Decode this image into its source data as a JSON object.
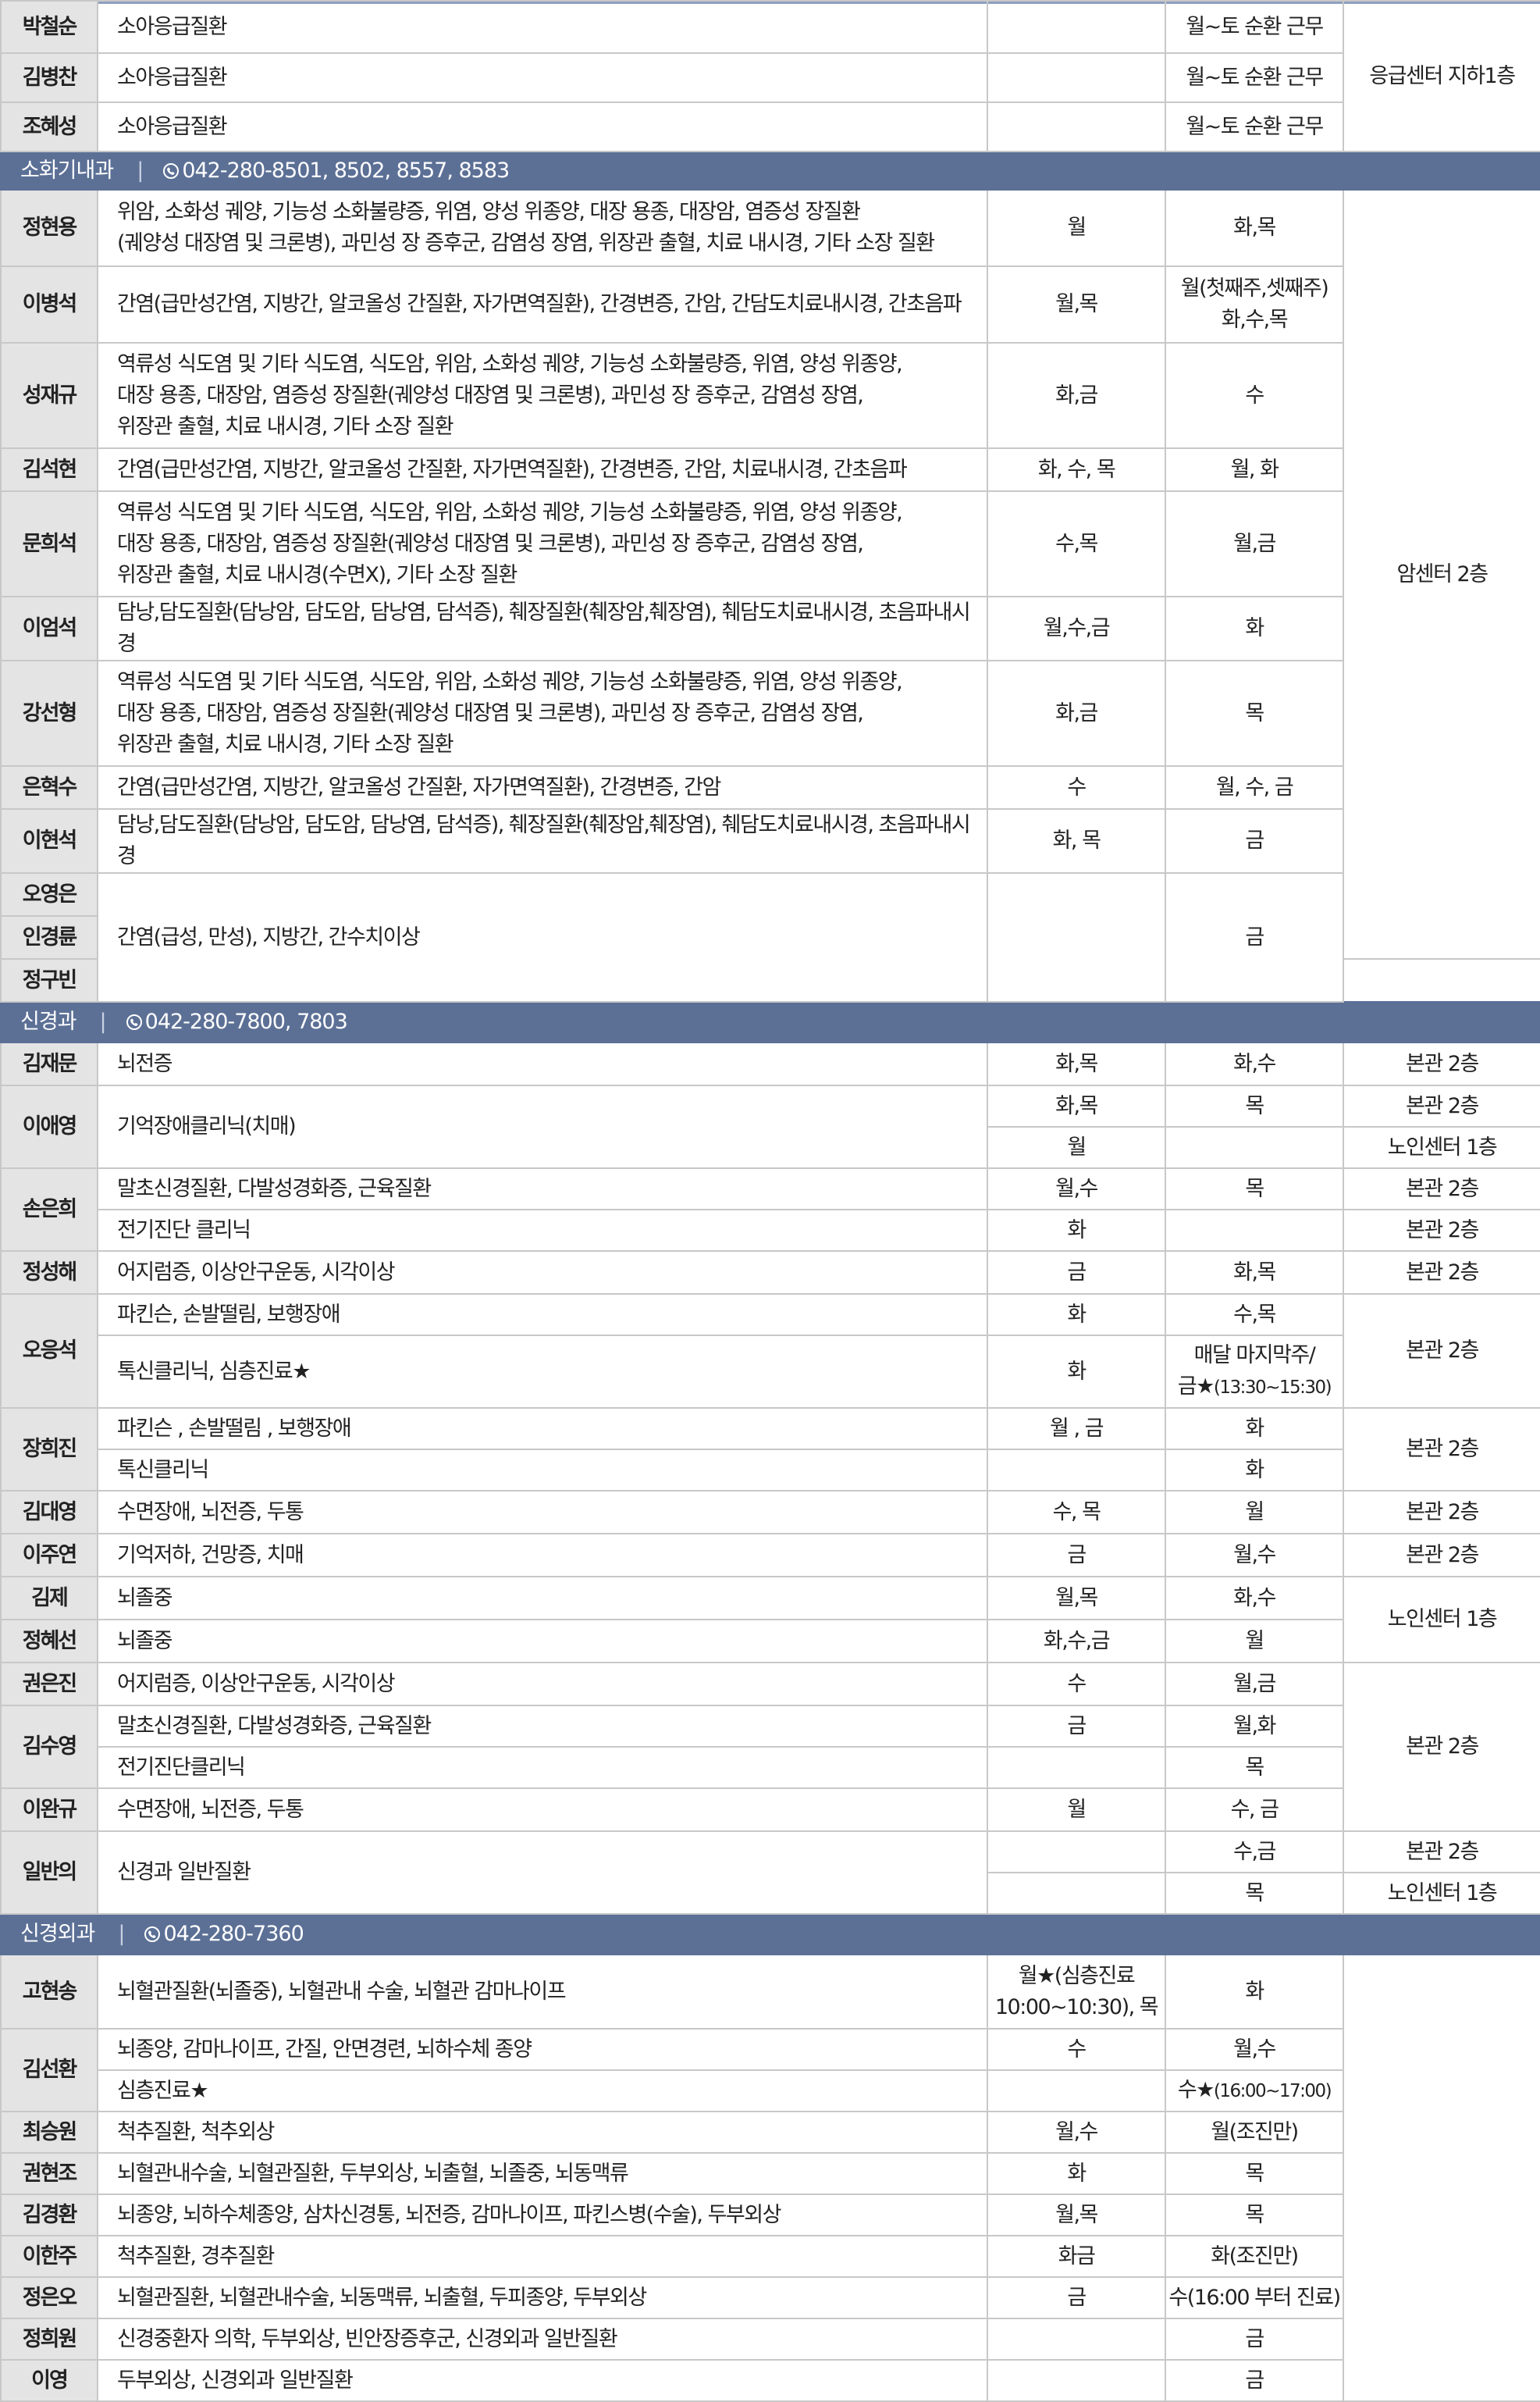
{
  "sections": {
    "pediatrics_tail": {
      "rows": [
        {
          "name": "박철순",
          "specialty": "소아응급질환",
          "clinic": "",
          "surgery": "월~토 순환 근무"
        },
        {
          "name": "김병찬",
          "specialty": "소아응급질환",
          "clinic": "",
          "surgery": "월~토 순환 근무"
        },
        {
          "name": "조혜성",
          "specialty": "소아응급질환",
          "clinic": "",
          "surgery": "월~토 순환 근무"
        }
      ],
      "location": "응급센터 지하1층"
    },
    "gastro": {
      "dept_name": "소화기내과",
      "phone": "042-280-8501, 8502, 8557, 8583",
      "location": "암센터 2층",
      "rows": [
        {
          "name": "정현용",
          "specialty": "위암, 소화성 궤양, 기능성 소화불량증, 위염, 양성 위종양, 대장 용종, 대장암, 염증성 장질환",
          "specialty2": "(궤양성 대장염 및 크론병), 과민성 장 증후군, 감염성 장염, 위장관 출혈, 치료 내시경, 기타 소장 질환",
          "clinic": "월",
          "surgery": "화,목"
        },
        {
          "name": "이병석",
          "specialty": "간염(급만성간염, 지방간, 알코올성 간질환, 자가면역질환), 간경변증, 간암, 간담도치료내시경, 간초음파",
          "clinic": "월,목",
          "surgery": "월(첫째주,셋째주)",
          "surgery2": "화,수,목"
        },
        {
          "name": "성재규",
          "specialty": "역류성 식도염 및 기타 식도염, 식도암, 위암, 소화성 궤양, 기능성 소화불량증, 위염, 양성 위종양,",
          "specialty2": "대장 용종, 대장암, 염증성 장질환(궤양성 대장염 및 크론병), 과민성 장 증후군, 감염성 장염,",
          "specialty3": "위장관 출혈, 치료 내시경, 기타 소장 질환",
          "clinic": "화,금",
          "surgery": "수"
        },
        {
          "name": "김석현",
          "specialty": "간염(급만성간염, 지방간, 알코올성 간질환, 자가면역질환), 간경변증, 간암, 치료내시경, 간초음파",
          "clinic": "화, 수, 목",
          "surgery": "월, 화"
        },
        {
          "name": "문희석",
          "specialty": "역류성 식도염 및 기타 식도염, 식도암, 위암, 소화성 궤양, 기능성 소화불량증, 위염, 양성 위종양,",
          "specialty2": "대장 용종, 대장암, 염증성 장질환(궤양성 대장염 및 크론병), 과민성 장 증후군, 감염성 장염,",
          "specialty3": "위장관 출혈, 치료 내시경(수면X), 기타 소장 질환",
          "clinic": "수,목",
          "surgery": "월,금"
        },
        {
          "name": "이엄석",
          "specialty": "담낭,담도질환(담낭암, 담도암, 담낭염, 담석증), 췌장질환(췌장암,췌장염), 췌담도치료내시경, 초음파내시경",
          "clinic": "월,수,금",
          "surgery": "화"
        },
        {
          "name": "강선형",
          "specialty": "역류성 식도염 및 기타 식도염, 식도암, 위암, 소화성 궤양, 기능성 소화불량증, 위염, 양성 위종양,",
          "specialty2": "대장 용종, 대장암, 염증성 장질환(궤양성 대장염 및 크론병), 과민성 장 증후군, 감염성 장염,",
          "specialty3": "위장관 출혈, 치료 내시경, 기타 소장 질환",
          "clinic": "화,금",
          "surgery": "목"
        },
        {
          "name": "은혁수",
          "specialty": "간염(급만성간염, 지방간, 알코올성 간질환, 자가면역질환), 간경변증, 간암",
          "clinic": "수",
          "surgery": "월, 수, 금"
        },
        {
          "name": "이현석",
          "specialty": "담낭,담도질환(담낭암, 담도암, 담낭염, 담석증), 췌장질환(췌장암,췌장염), 췌담도치료내시경, 초음파내시경",
          "clinic": "화, 목",
          "surgery": "금"
        }
      ],
      "group": {
        "names": [
          "오영은",
          "인경륜",
          "정구빈"
        ],
        "specialty": "간염(급성, 만성), 지방간, 간수치이상",
        "clinic": "",
        "surgery": "금"
      }
    },
    "neuro": {
      "dept_name": "신경과",
      "phone": "042-280-7800, 7803",
      "locations": {
        "bongwan": "본관 2층",
        "noin": "노인센터 1층"
      },
      "rows": {
        "r1": {
          "name": "김재문",
          "specialty": "뇌전증",
          "clinic": "화,목",
          "surgery": "화,수"
        },
        "r2": {
          "name": "이애영",
          "specialty": "기억장애클리닉(치매)",
          "clinic_a": "화,목",
          "surgery_a": "목",
          "clinic_b": "월"
        },
        "r3": {
          "name": "손은희",
          "specialty_a": "말초신경질환, 다발성경화증, 근육질환",
          "clinic_a": "월,수",
          "surgery_a": "목",
          "specialty_b": "전기진단 클리닉",
          "clinic_b": "화"
        },
        "r4": {
          "name": "정성해",
          "specialty": "어지럼증, 이상안구운동, 시각이상",
          "clinic": "금",
          "surgery": "화,목"
        },
        "r5": {
          "name": "오응석",
          "specialty_a": "파킨슨, 손발떨림, 보행장애",
          "clinic_a": "화",
          "surgery_a": "수,목",
          "specialty_b": "톡신클리닉, 심층진료★",
          "clinic_b": "화",
          "surgery_b": "매달 마지막주/",
          "surgery_b2": "금★",
          "surgery_b2_time": "(13:30~15:30)"
        },
        "r6": {
          "name": "장희진",
          "specialty_a": "파킨슨 , 손발떨림 , 보행장애",
          "clinic_a": "월 , 금",
          "surgery_a": "화",
          "specialty_b": "톡신클리닉",
          "surgery_b": "화"
        },
        "r7": {
          "name": "김대영",
          "specialty": "수면장애, 뇌전증, 두통",
          "clinic": "수, 목",
          "surgery": "월"
        },
        "r8": {
          "name": "이주연",
          "specialty": "기억저하, 건망증, 치매",
          "clinic": "금",
          "surgery": "월,수"
        },
        "r9": {
          "name": "김제",
          "specialty": "뇌졸중",
          "clinic": "월,목",
          "surgery": "화,수"
        },
        "r10": {
          "name": "정혜선",
          "specialty": "뇌졸중",
          "clinic": "화,수,금",
          "surgery": "월"
        },
        "r11": {
          "name": "권은진",
          "specialty": "어지럼증, 이상안구운동, 시각이상",
          "clinic": "수",
          "surgery": "월,금"
        },
        "r12": {
          "name": "김수영",
          "specialty_a": "말초신경질환, 다발성경화증, 근육질환",
          "clinic_a": "금",
          "surgery_a": "월,화",
          "specialty_b": "전기진단클리닉",
          "surgery_b": "목"
        },
        "r13": {
          "name": "이완규",
          "specialty": "수면장애, 뇌전증, 두통",
          "clinic": "월",
          "surgery": "수, 금"
        },
        "r14": {
          "name": "일반의",
          "specialty": "신경과 일반질환",
          "surgery_a": "수,금",
          "surgery_b": "목"
        }
      }
    },
    "neurosurg": {
      "dept_name": "신경외과",
      "phone": "042-280-7360",
      "rows": {
        "r1": {
          "name": "고현송",
          "specialty": "뇌혈관질환(뇌졸중), 뇌혈관내 수술, 뇌혈관 감마나이프",
          "clinic": "월★(심층진료",
          "clinic2": "10:00~10:30), 목",
          "surgery": "화"
        },
        "r2": {
          "name": "김선환",
          "specialty_a": "뇌종양, 감마나이프, 간질, 안면경련, 뇌하수체 종양",
          "clinic_a": "수",
          "surgery_a": "월,수",
          "specialty_b": "심층진료★",
          "surgery_b": "수★",
          "surgery_b_time": "(16:00~17:00)"
        },
        "r3": {
          "name": "최승원",
          "specialty": "척추질환, 척추외상",
          "clinic": "월,수",
          "surgery": "월(조진만)"
        },
        "r4": {
          "name": "권현조",
          "specialty": "뇌혈관내수술, 뇌혈관질환, 두부외상, 뇌출혈, 뇌졸중, 뇌동맥류",
          "clinic": "화",
          "surgery": "목"
        },
        "r5": {
          "name": "김경환",
          "specialty": "뇌종양, 뇌하수체종양, 삼차신경통, 뇌전증, 감마나이프, 파킨스병(수술), 두부외상",
          "clinic": "월,목",
          "surgery": "목"
        },
        "r6": {
          "name": "이한주",
          "specialty": "척추질환, 경추질환",
          "clinic": "화금",
          "surgery": "화(조진만)"
        },
        "r7": {
          "name": "정은오",
          "specialty": "뇌혈관질환, 뇌혈관내수술, 뇌동맥류, 뇌출혈, 두피종양, 두부외상",
          "clinic": "금",
          "surgery": "수(16:00 부터 진료)"
        },
        "r8": {
          "name": "정희원",
          "specialty": "신경중환자 의학, 두부외상, 빈안장증후군, 신경외과 일반질환",
          "clinic": "",
          "surgery": "금"
        },
        "r9": {
          "name": "이영",
          "specialty": "두부외상, 신경외과 일반질환",
          "clinic": "",
          "surgery": "금"
        }
      }
    }
  },
  "icons": {
    "phone": "phone-icon"
  },
  "colors": {
    "header_bg": "#5c7096",
    "name_bg": "#e4e4e4",
    "border": "#c8c8c8"
  }
}
